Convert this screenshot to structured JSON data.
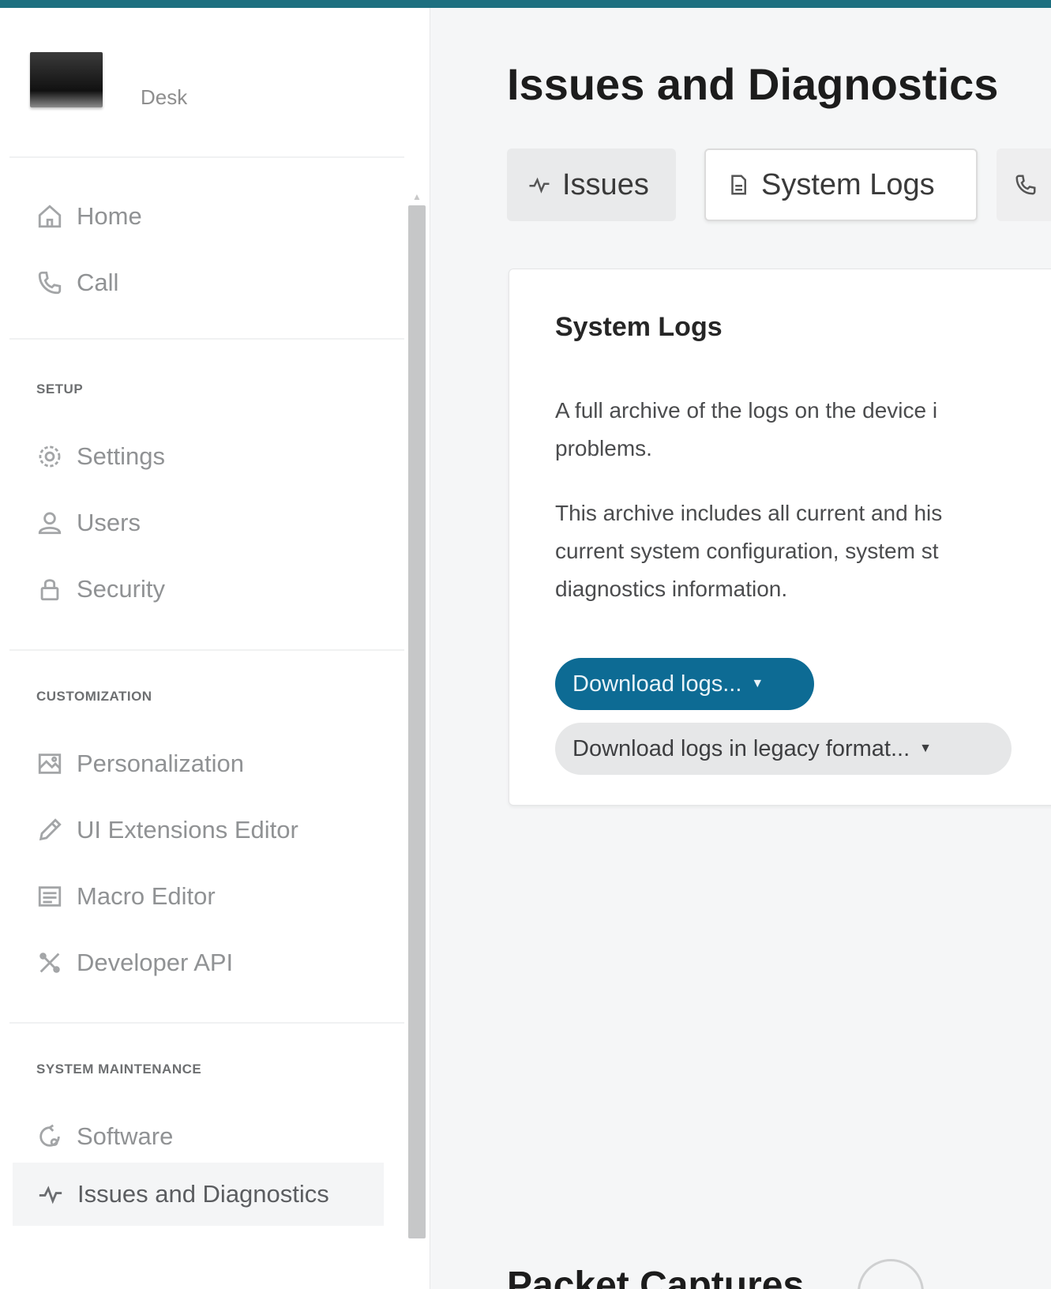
{
  "device": {
    "name": "Desk"
  },
  "nav": {
    "top": [
      {
        "label": "Home",
        "icon": "home-icon"
      },
      {
        "label": "Call",
        "icon": "phone-icon"
      }
    ],
    "setup": {
      "heading": "SETUP",
      "items": [
        {
          "label": "Settings",
          "icon": "gear-icon"
        },
        {
          "label": "Users",
          "icon": "user-icon"
        },
        {
          "label": "Security",
          "icon": "lock-icon"
        }
      ]
    },
    "customization": {
      "heading": "CUSTOMIZATION",
      "items": [
        {
          "label": "Personalization",
          "icon": "image-icon"
        },
        {
          "label": "UI Extensions Editor",
          "icon": "pencil-icon"
        },
        {
          "label": "Macro Editor",
          "icon": "macro-icon"
        },
        {
          "label": "Developer API",
          "icon": "api-icon"
        }
      ]
    },
    "maintenance": {
      "heading": "SYSTEM MAINTENANCE",
      "items": [
        {
          "label": "Software",
          "icon": "software-icon"
        },
        {
          "label": "Issues and Diagnostics",
          "icon": "pulse-icon",
          "active": true
        }
      ]
    }
  },
  "main": {
    "title": "Issues and Diagnostics",
    "tabs": [
      {
        "label": "Issues",
        "icon": "pulse-icon"
      },
      {
        "label": "System Logs",
        "icon": "document-icon",
        "selected": true
      },
      {
        "label": "",
        "icon": "phone-settings-icon"
      }
    ],
    "card": {
      "title": "System Logs",
      "paragraph1_line1": "A full archive of the logs on the device i",
      "paragraph1_line2": "problems.",
      "paragraph2_line1": "This archive includes all current and his",
      "paragraph2_line2": "current system configuration, system st",
      "paragraph2_line3": "diagnostics information.",
      "primary_button": "Download logs...",
      "secondary_button": "Download logs in legacy format..."
    },
    "next_section_heading": "Packet Captures"
  },
  "colors": {
    "topbar": "#1d6f80",
    "primary_button": "#0d6b94",
    "active_indicator": "#111111"
  }
}
